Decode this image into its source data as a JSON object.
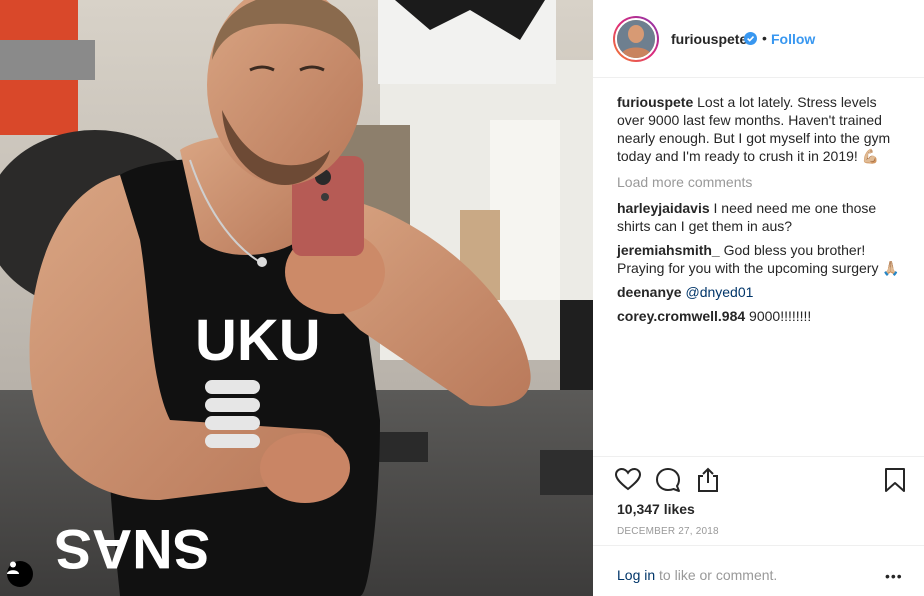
{
  "post": {
    "username": "furiouspete",
    "follow_label": "Follow",
    "separator": "•",
    "caption": "Lost a lot lately. Stress levels over 9000 last few months. Haven't trained nearly enough. But I got myself into the gym today and I'm ready to crush it in 2019! 💪🏼",
    "load_more": "Load more comments",
    "comments": [
      {
        "user": "harleyjaidavis",
        "text": "I need need me one those shirts can I get them in aus?"
      },
      {
        "user": "jeremiahsmith_",
        "text": "God bless you brother! Praying for you with the upcoming surgery 🙏🏼"
      },
      {
        "user": "deenanye",
        "text": "@dnyed01"
      },
      {
        "user": "corey.cromwell.984",
        "text": "9000!!!!!!!!"
      }
    ],
    "likes": "10,347 likes",
    "date": "DECEMBER 27, 2018",
    "login_link": "Log in",
    "login_rest": " to like or comment.",
    "more_label": "•••"
  },
  "photo": {
    "shirt_text_top": "UKU",
    "shirt_text_bottom": "SNAS"
  },
  "icons": [
    "heart-icon",
    "comment-icon",
    "share-icon",
    "bookmark-icon",
    "verified-icon",
    "user-tag-icon"
  ],
  "colors": {
    "link": "#3897f0",
    "mention": "#003569",
    "muted": "#999999",
    "text": "#262626"
  }
}
